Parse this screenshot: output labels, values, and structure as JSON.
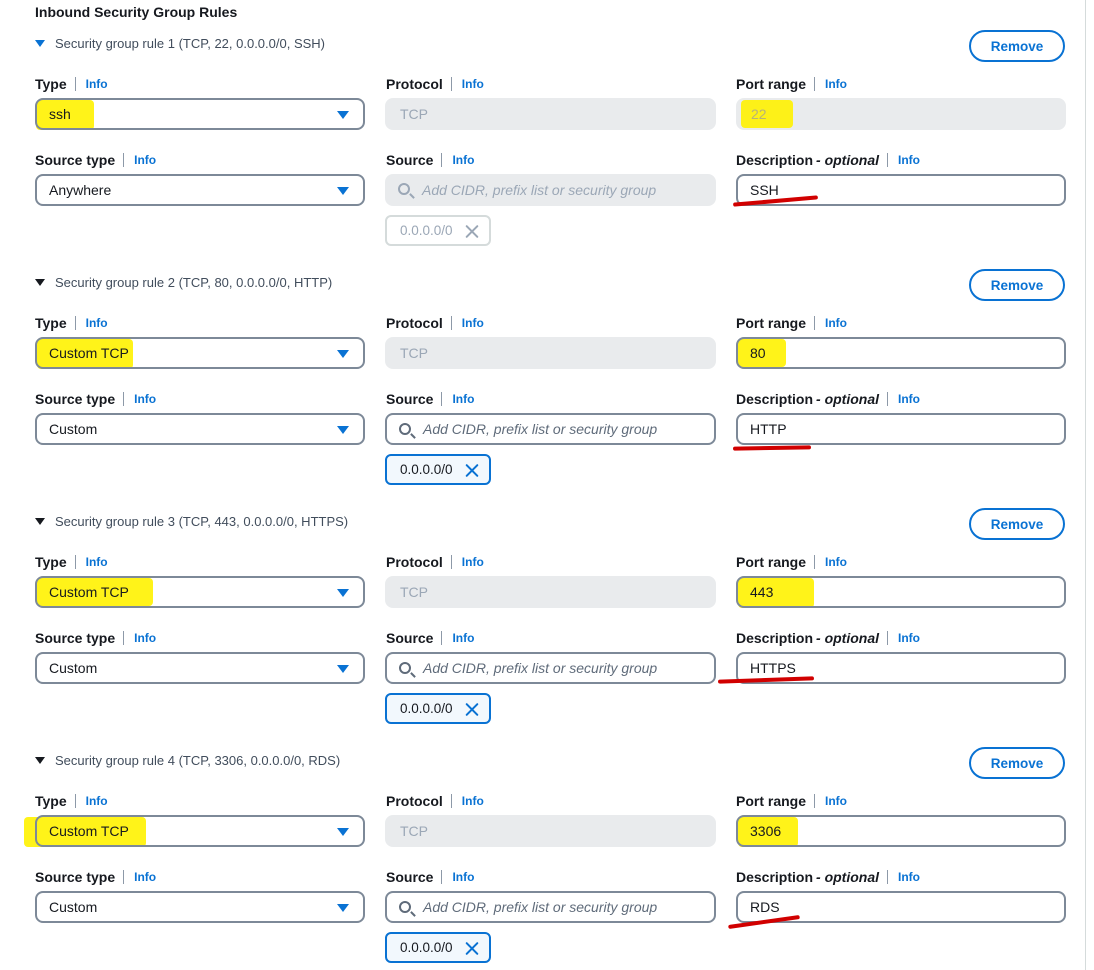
{
  "section_title": "Inbound Security Group Rules",
  "labels": {
    "type": "Type",
    "protocol": "Protocol",
    "port_range": "Port range",
    "source_type": "Source type",
    "source": "Source",
    "description": "Description",
    "optional": "- optional",
    "info": "Info"
  },
  "remove_label": "Remove",
  "source_placeholder": "Add CIDR, prefix list or security group",
  "rules": [
    {
      "header": "Security group rule 1 (TCP, 22, 0.0.0.0/0, SSH)",
      "type": "ssh",
      "protocol": "TCP",
      "port": "22",
      "source_type": "Anywhere",
      "token": "0.0.0.0/0",
      "description": "SSH",
      "editable": false
    },
    {
      "header": "Security group rule 2 (TCP, 80, 0.0.0.0/0, HTTP)",
      "type": "Custom TCP",
      "protocol": "TCP",
      "port": "80",
      "source_type": "Custom",
      "token": "0.0.0.0/0",
      "description": "HTTP",
      "editable": true
    },
    {
      "header": "Security group rule 3 (TCP, 443, 0.0.0.0/0, HTTPS)",
      "type": "Custom TCP",
      "protocol": "TCP",
      "port": "443",
      "source_type": "Custom",
      "token": "0.0.0.0/0",
      "description": "HTTPS",
      "editable": true
    },
    {
      "header": "Security group rule 4 (TCP, 3306, 0.0.0.0/0, RDS)",
      "type": "Custom TCP",
      "protocol": "TCP",
      "port": "3306",
      "source_type": "Custom",
      "token": "0.0.0.0/0",
      "description": "RDS",
      "editable": true
    }
  ],
  "colors": {
    "accent": "#0972d3",
    "highlight": "#fff200",
    "annotation_underline": "#d10000"
  }
}
